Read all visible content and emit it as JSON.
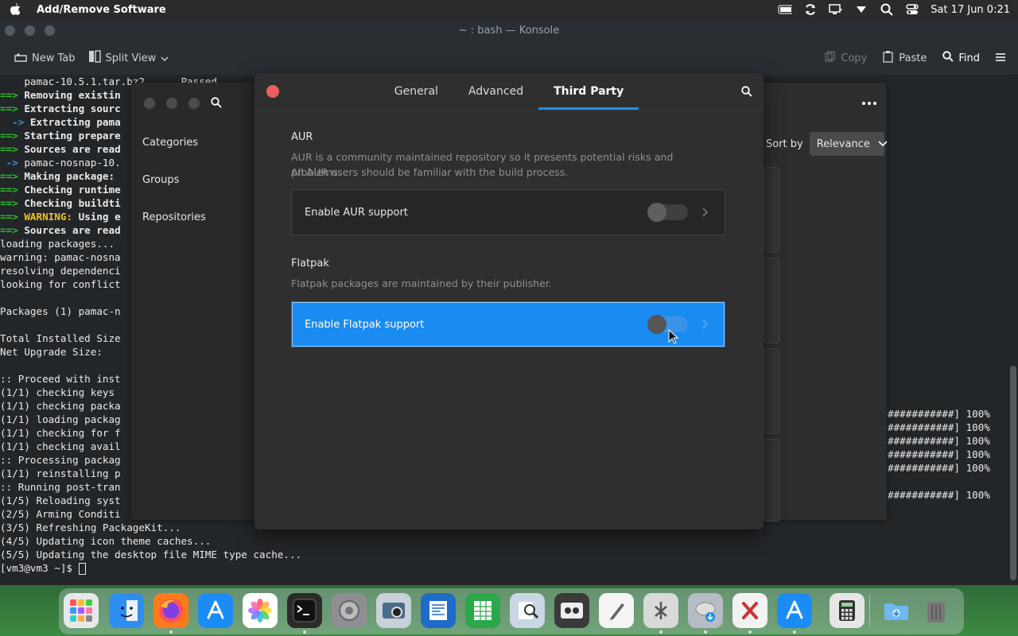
{
  "menubar": {
    "app_title": "Add/Remove Software",
    "datetime": "Sat 17 Jun 0:21"
  },
  "konsole": {
    "window_title": "~ : bash — Konsole",
    "toolbar": {
      "new_tab": "New Tab",
      "split_view": "Split View",
      "copy": "Copy",
      "paste": "Paste",
      "find": "Find"
    },
    "lines": [
      "    pamac-10.5.1.tar.bz2      Passed",
      "==> Removing existin",
      "==> Extracting sourc",
      "  -> Extracting pama",
      "==> Starting prepare",
      "==> Sources are read",
      " -> pamac-nosnap-10.",
      "==> Making package: ",
      "==> Checking runtime",
      "==> Checking buildti",
      "==> WARNING: Using e",
      "==> Sources are read",
      "loading packages...",
      "warning: pamac-nosna",
      "resolving dependenci",
      "looking for conflict",
      "",
      "Packages (1) pamac-n",
      "",
      "Total Installed Size",
      "Net Upgrade Size:",
      "",
      ":: Proceed with inst",
      "(1/1) checking keys ",
      "(1/1) checking packa",
      "(1/1) loading packag",
      "(1/1) checking for f",
      "(1/1) checking avail",
      ":: Processing packag",
      "(1/1) reinstalling p",
      ":: Running post-tran",
      "(1/5) Reloading syst",
      "(2/5) Arming Conditi",
      "(3/5) Refreshing PackageKit...",
      "(4/5) Updating icon theme caches...",
      "(5/5) Updating the desktop file MIME type cache...",
      "[vm3@vm3 ~]$ "
    ],
    "progress_lines": [
      "###########] 100%",
      "###########] 100%",
      "###########] 100%",
      "###########] 100%",
      "###########] 100%",
      "",
      "###########] 100%"
    ]
  },
  "pamac": {
    "sidebar": [
      "Categories",
      "Groups",
      "Repositories"
    ],
    "sort_label": "Sort by",
    "sort_value": "Relevance"
  },
  "dialog": {
    "tabs": [
      "General",
      "Advanced",
      "Third Party"
    ],
    "active_tab": "Third Party",
    "aur": {
      "title": "AUR",
      "desc_1": "AUR is a community maintained repository so it presents potential risks and problems.",
      "desc_2": "All AUR users should be familiar with the build process.",
      "toggle_label": "Enable AUR support",
      "enabled": false
    },
    "flatpak": {
      "title": "Flatpak",
      "desc": "Flatpak packages are maintained by their publisher.",
      "toggle_label": "Enable Flatpak support",
      "enabled": false
    }
  },
  "dock": {
    "items": [
      "launchpad-icon",
      "finder-icon",
      "firefox-icon",
      "app-store-icon",
      "photos-icon",
      "terminal-icon",
      "settings-icon",
      "screenshot-icon",
      "document-viewer-icon",
      "spreadsheet-icon",
      "preview-icon",
      "tape-recorder-icon",
      "text-editor-icon",
      "system-tools-icon",
      "disk-installer-icon",
      "xcode-icon",
      "software-store-icon",
      "calculator-icon",
      "downloads-folder-icon",
      "trash-icon"
    ]
  },
  "colors": {
    "accent": "#1a8bf0",
    "close": "#ed5f5c",
    "dialog_bg": "#2f2f2f",
    "terminal_bg": "#232629"
  }
}
